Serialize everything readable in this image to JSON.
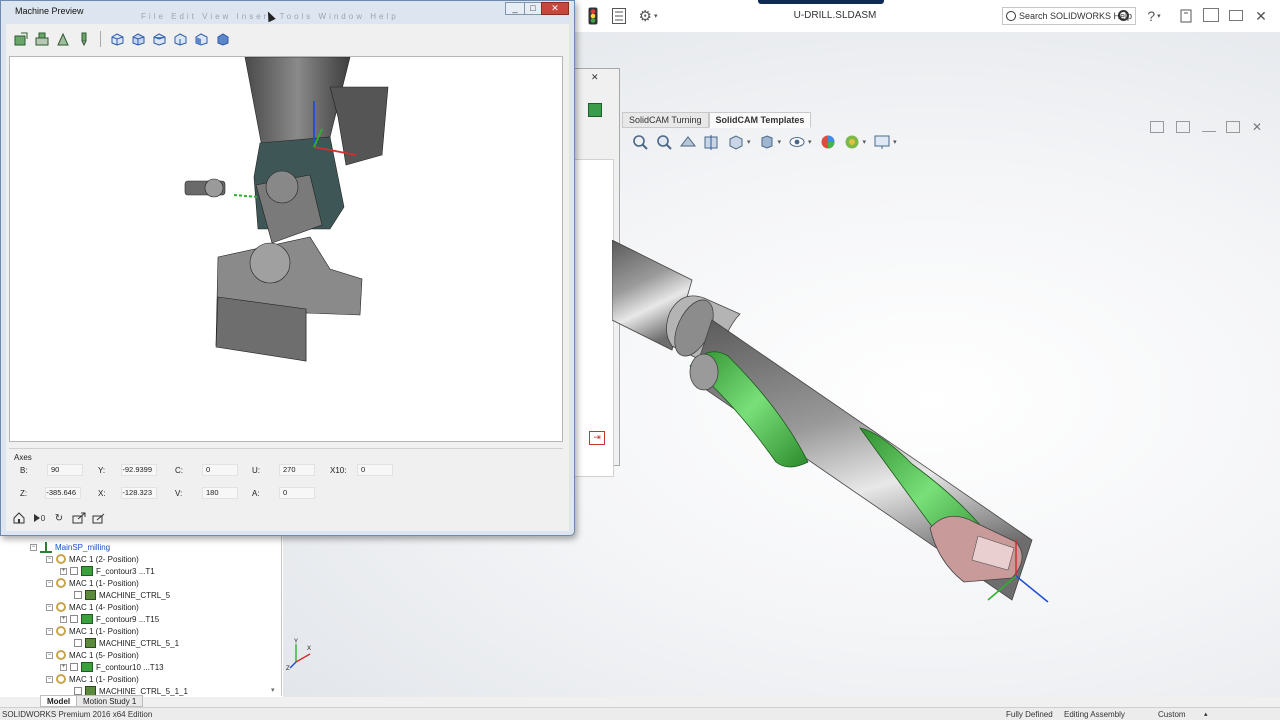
{
  "app": {
    "doc_title": "U-DRILL.SLDASM",
    "search_placeholder": "Search SOLIDWORKS Help",
    "help_icon": "?"
  },
  "graphics": {
    "tabs": [
      {
        "label": "SolidCAM Turning",
        "active": false
      },
      {
        "label": "SolidCAM Templates",
        "active": true
      }
    ],
    "triad_labels": {
      "x": "X",
      "y": "Y",
      "z": "Z"
    },
    "part_colors": {
      "body": "#8a8a8a",
      "flute": "#4cc04c",
      "tip": "#c89a9a"
    }
  },
  "machine_preview": {
    "title": "Machine Preview",
    "menu_ghost": "File Edit View Insert Tools Window Help",
    "axes_title": "Axes",
    "axes": {
      "B": {
        "label": "B:",
        "value": "90"
      },
      "Y": {
        "label": "Y:",
        "value": "-92.9399"
      },
      "C": {
        "label": "C:",
        "value": "0"
      },
      "U": {
        "label": "U:",
        "value": "270"
      },
      "X10": {
        "label": "X10:",
        "value": "0"
      },
      "Z": {
        "label": "Z:",
        "value": "-385.646"
      },
      "X": {
        "label": "X:",
        "value": "-128.323"
      },
      "V": {
        "label": "V:",
        "value": "180"
      },
      "A": {
        "label": "A:",
        "value": "0"
      }
    },
    "bottom_play_label": "0"
  },
  "tree": {
    "rows": [
      {
        "label": "MainSP_milling",
        "kind": "setup"
      },
      {
        "label": "MAC 1 (2- Position)",
        "kind": "mac"
      },
      {
        "label": "F_contour3 ...T1",
        "kind": "op"
      },
      {
        "label": "MAC 1 (1- Position)",
        "kind": "mac"
      },
      {
        "label": "MACHINE_CTRL_5",
        "kind": "mc"
      },
      {
        "label": "MAC 1 (4- Position)",
        "kind": "mac"
      },
      {
        "label": "F_contour9 ...T15",
        "kind": "op"
      },
      {
        "label": "MAC 1 (1- Position)",
        "kind": "mac"
      },
      {
        "label": "MACHINE_CTRL_5_1",
        "kind": "mc"
      },
      {
        "label": "MAC 1 (5- Position)",
        "kind": "mac"
      },
      {
        "label": "F_contour10 ...T13",
        "kind": "op"
      },
      {
        "label": "MAC 1 (1- Position)",
        "kind": "mac"
      },
      {
        "label": "MACHINE_CTRL_5_1_1",
        "kind": "mc"
      }
    ]
  },
  "bottom_tabs": {
    "model": "Model",
    "motion": "Motion Study 1"
  },
  "status": {
    "edition": "SOLIDWORKS Premium 2016 x64 Edition",
    "defined": "Fully Defined",
    "mode": "Editing Assembly",
    "units": "Custom"
  }
}
